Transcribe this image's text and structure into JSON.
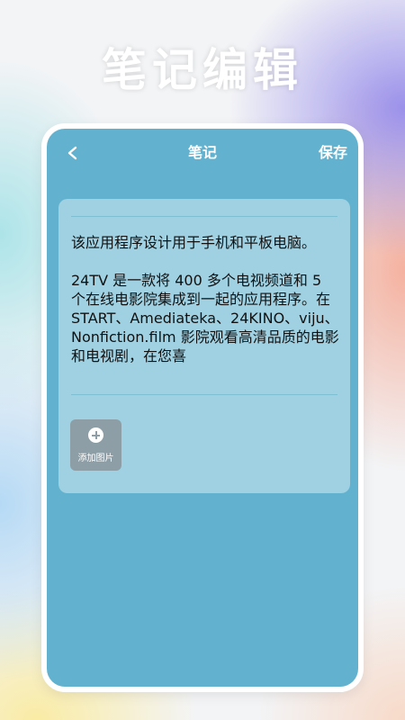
{
  "headline": "笔记编辑",
  "topbar": {
    "back_icon": "chevron-left-icon",
    "title": "笔记",
    "save_label": "保存"
  },
  "note": {
    "content": "该应用程序设计用于手机和平板电脑。\n\n24TV 是一款将 400 多个电视频道和 5 个在线电影院集成到一起的应用程序。在 START、Amediateka、24KINO、viju、Nonfiction.film 影院观看高清品质的电影和电视剧，在您喜"
  },
  "add_image": {
    "icon": "plus-circle-icon",
    "label": "添加图片"
  },
  "colors": {
    "screen_bg": "#62b2cf",
    "card_bg": "#9fd1e2",
    "button_bg": "#8e9ea6"
  }
}
